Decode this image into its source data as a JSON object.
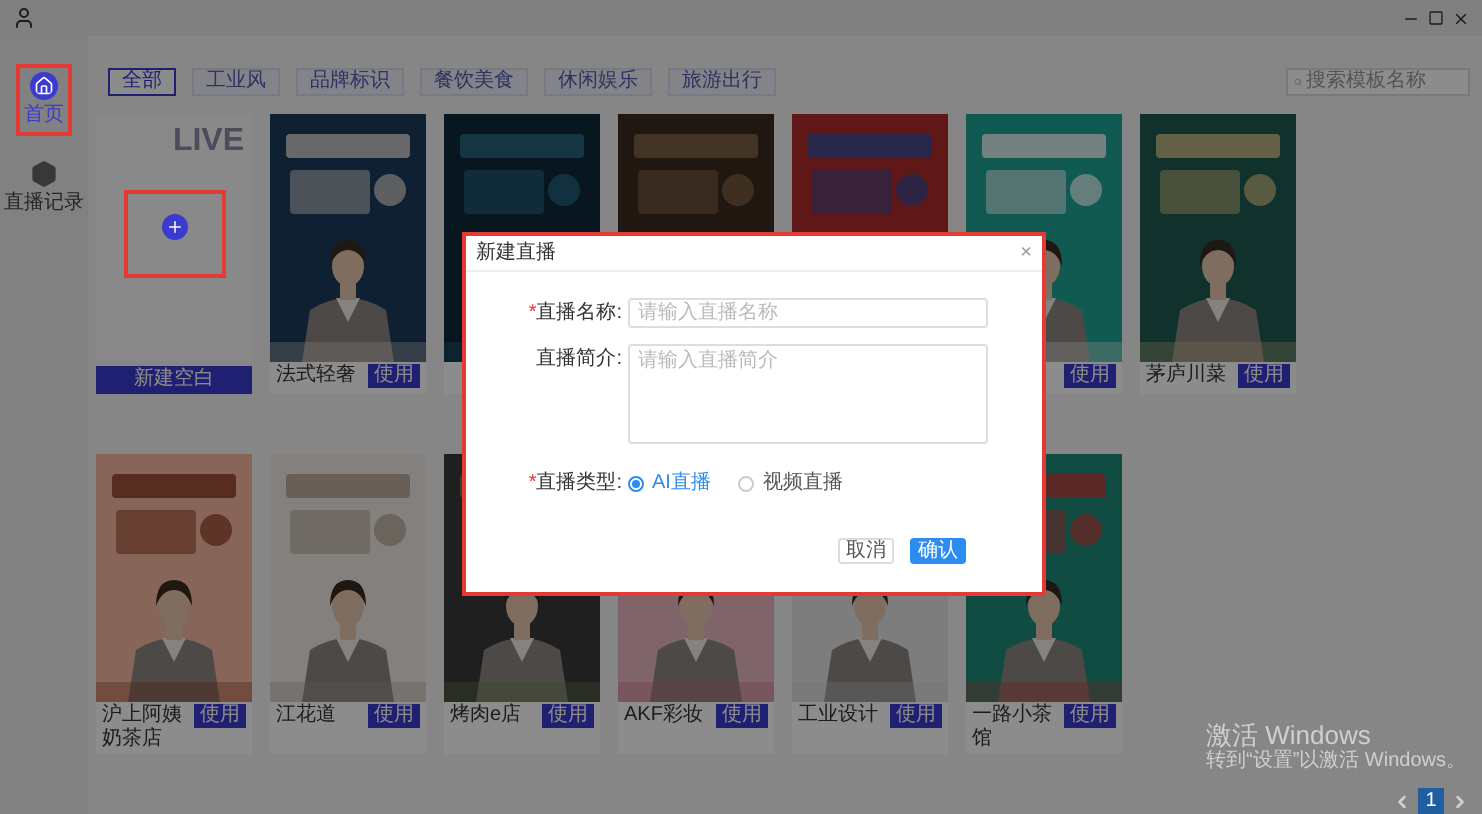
{
  "sidebar": {
    "items": [
      {
        "label": "首页",
        "selected": true
      },
      {
        "label": "直播记录",
        "selected": false
      }
    ]
  },
  "filters": [
    {
      "label": "全部",
      "selected": true
    },
    {
      "label": "工业风",
      "selected": false
    },
    {
      "label": "品牌标识",
      "selected": false
    },
    {
      "label": "餐饮美食",
      "selected": false
    },
    {
      "label": "休闲娱乐",
      "selected": false
    },
    {
      "label": "旅游出行",
      "selected": false
    }
  ],
  "search": {
    "placeholder": "搜索模板名称"
  },
  "new_blank": {
    "watermark": "LIVE",
    "button": "新建空白"
  },
  "templates": [
    {
      "kind": "template",
      "name": "法式轻奢",
      "button": "使用"
    },
    {
      "kind": "picture"
    },
    {
      "kind": "picture"
    },
    {
      "kind": "picture"
    },
    {
      "kind": "template",
      "button": "使用"
    },
    {
      "kind": "template",
      "name": "茅庐川菜",
      "button": "使用"
    },
    {
      "kind": "template",
      "name": "沪上阿姨奶茶店",
      "button": "使用"
    },
    {
      "kind": "template",
      "name": "江花道",
      "button": "使用"
    },
    {
      "kind": "template",
      "name": "烤肉e店",
      "button": "使用"
    },
    {
      "kind": "template",
      "name": "AKF彩妆",
      "button": "使用"
    },
    {
      "kind": "template",
      "name": "工业设计",
      "button": "使用"
    },
    {
      "kind": "template",
      "name": "一路小茶馆",
      "button": "使用"
    }
  ],
  "pagination": {
    "pages": [
      {
        "label": "1",
        "selected": true
      }
    ]
  },
  "os_notice": {
    "title": "激活 Windows",
    "text": "转到“设置”以激活 Windows。"
  },
  "dialog": {
    "title": "新建直播",
    "close": "×",
    "fields": [
      {
        "kind": "input",
        "mark": "*",
        "label": "直播名称:",
        "placeholder": "请输入直播名称"
      },
      {
        "kind": "textarea",
        "label": "直播简介:",
        "placeholder": "请输入直播简介"
      }
    ],
    "type_field": {
      "mark": "*",
      "label": "直播类型:",
      "options": [
        {
          "label": "AI直播",
          "selected": true
        },
        {
          "label": "视频直播",
          "selected": false
        }
      ]
    },
    "buttons": [
      {
        "label": "取消",
        "primary": false
      },
      {
        "label": "确认",
        "primary": true
      }
    ]
  }
}
